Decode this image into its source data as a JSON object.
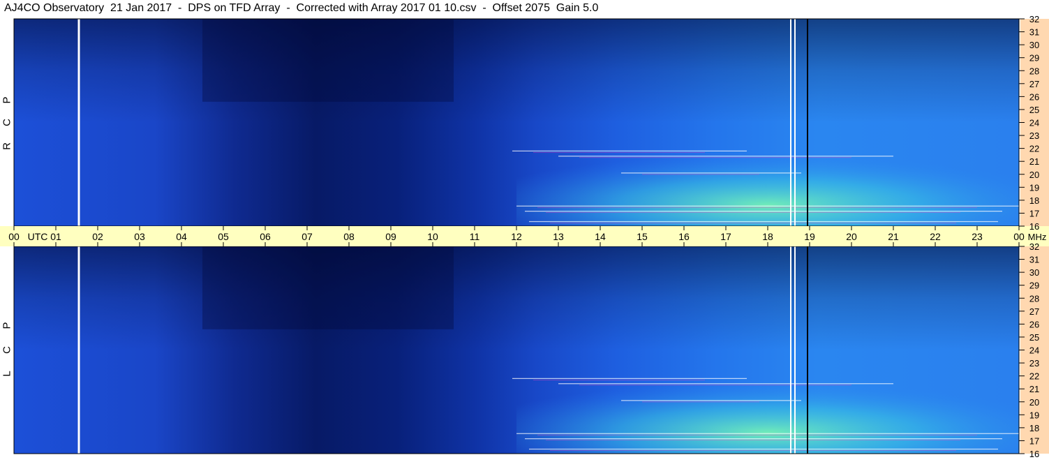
{
  "title": "AJ4CO Observatory  21 Jan 2017  -  DPS on TFD Array  -  Corrected with Array 2017 01 10.csv  -  Offset 2075  Gain 5.0",
  "panels": [
    {
      "label_letters": [
        "R",
        "C",
        "P"
      ]
    },
    {
      "label_letters": [
        "L",
        "C",
        "P"
      ]
    }
  ],
  "colors": {
    "axis_band": "#ffffc0",
    "right_bar": "#ffd8b0",
    "background": "#1a4fd0",
    "deep_minimum": "#02093a",
    "activity": "#6dffb0"
  },
  "chart_data": {
    "type": "heatmap",
    "x_unit": "UTC",
    "y_unit": "MHz",
    "x_ticks": [
      "00",
      "01",
      "02",
      "03",
      "04",
      "05",
      "06",
      "07",
      "08",
      "09",
      "10",
      "11",
      "12",
      "13",
      "14",
      "15",
      "16",
      "17",
      "18",
      "19",
      "20",
      "21",
      "22",
      "23",
      "00"
    ],
    "x_first_label": "00",
    "x_utc_label": "UTC",
    "x_last_label": "00",
    "x_mhz_label": "MHz",
    "xlim_hours": [
      0,
      24
    ],
    "y_ticks": [
      32,
      31,
      30,
      29,
      28,
      27,
      26,
      25,
      24,
      23,
      22,
      21,
      20,
      19,
      18,
      17,
      16
    ],
    "ylim_mhz": [
      16,
      32
    ],
    "panels": [
      "RCP",
      "LCP"
    ],
    "colormap": "blue-to-green spectrogram",
    "vertical_markers_utc": [
      1.55,
      18.55,
      18.65,
      18.95
    ],
    "dark_region_utc": [
      4.5,
      10.5
    ],
    "active_region_utc": [
      12,
      24
    ],
    "active_region_mhz": [
      16,
      22.5
    ]
  }
}
